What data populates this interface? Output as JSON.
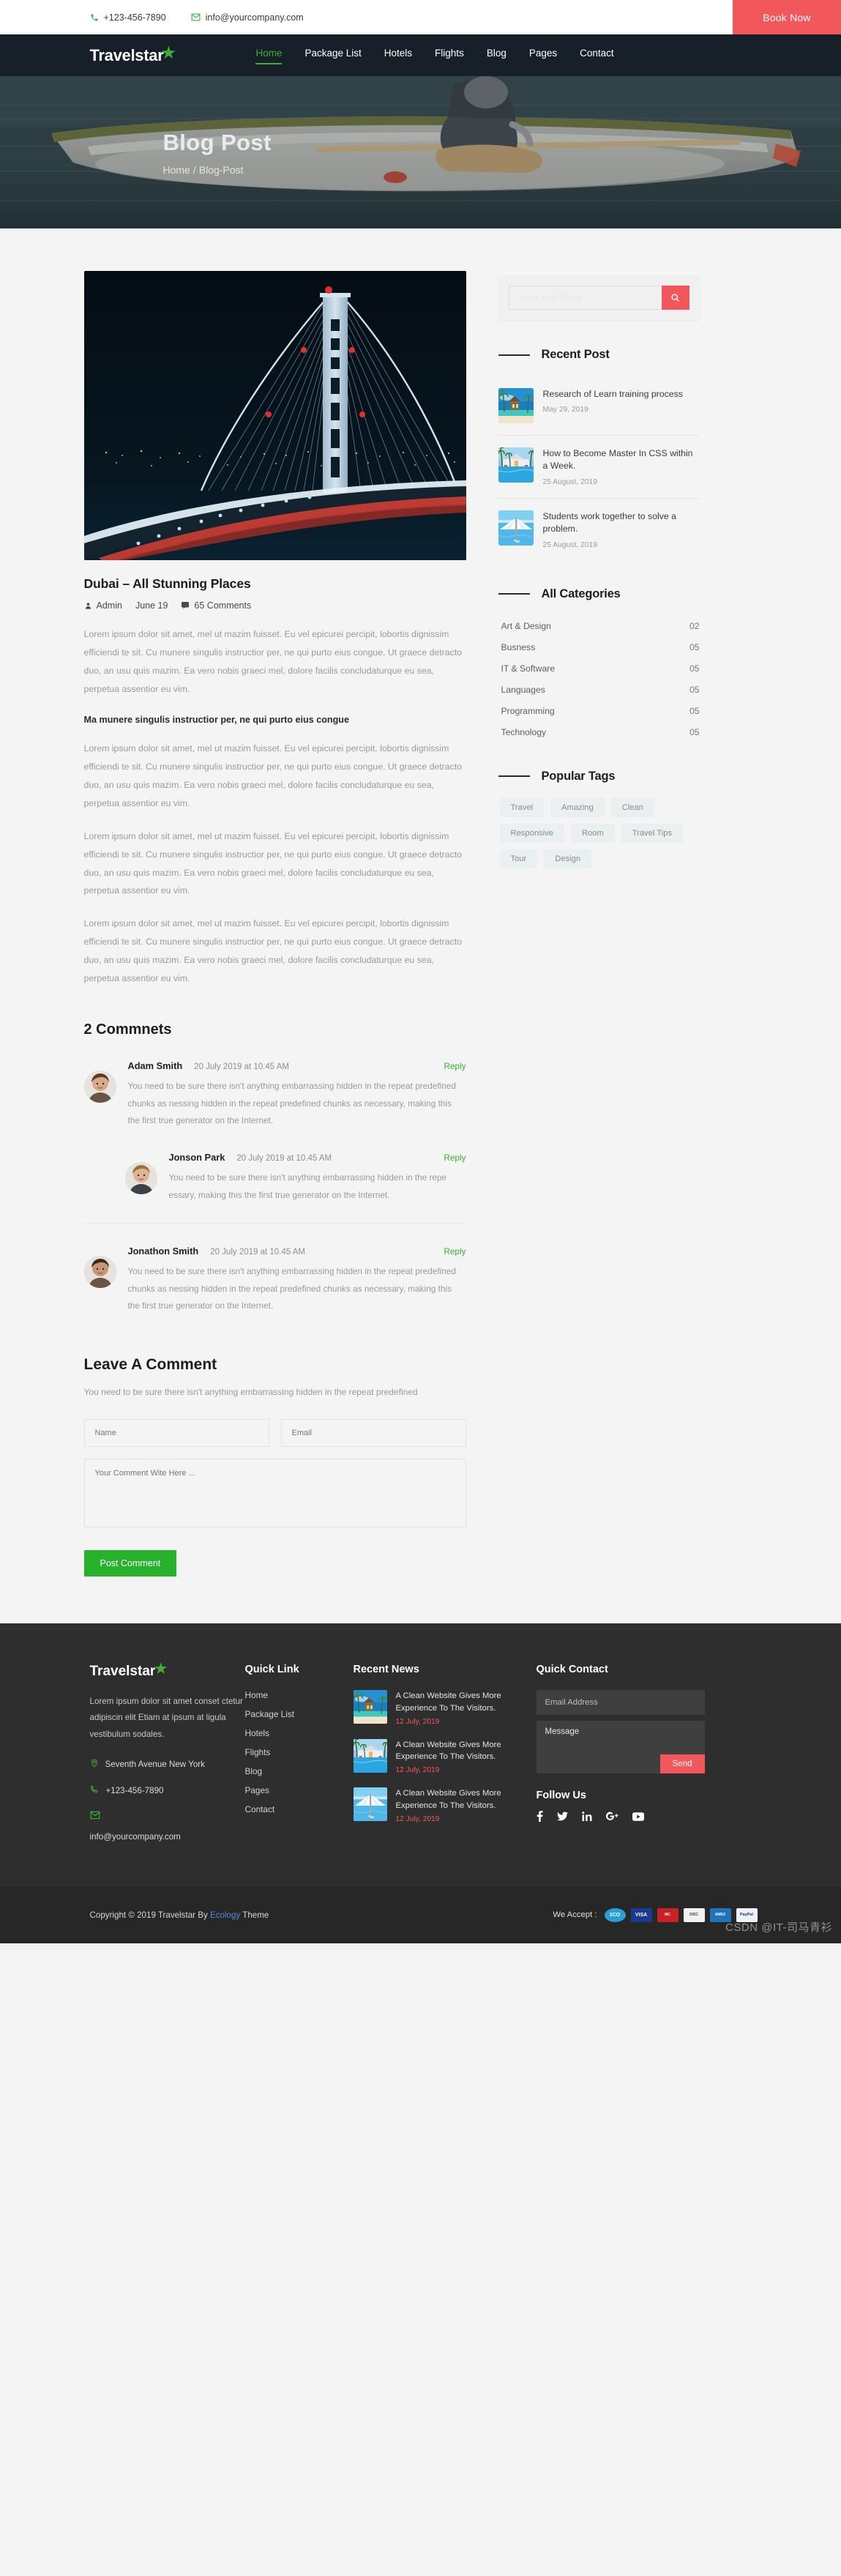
{
  "topbar": {
    "phone": "+123-456-7890",
    "email": "info@yourcompany.com",
    "book_now": "Book Now",
    "phone_icon": "phone-icon",
    "email_icon": "envelope-icon"
  },
  "nav": {
    "logo": "Travelstar",
    "items": [
      {
        "label": "Home",
        "active": true
      },
      {
        "label": "Package List",
        "active": false
      },
      {
        "label": "Hotels",
        "active": false
      },
      {
        "label": "Flights",
        "active": false
      },
      {
        "label": "Blog",
        "active": false
      },
      {
        "label": "Pages",
        "active": false
      },
      {
        "label": "Contact",
        "active": false
      }
    ]
  },
  "hero": {
    "title": "Blog Post",
    "crumb_home": "Home",
    "crumb_sep": "/",
    "crumb_current": "Blog-Post"
  },
  "post": {
    "title": "Dubai – All Stunning Places",
    "author": "Admin",
    "date": "June 19",
    "comments": "65 Comments",
    "author_icon": "user-icon",
    "comment_icon": "comment-icon",
    "paragraphs": [
      "Lorem ipsum dolor sit amet, mel ut mazim fuisset. Eu vel epicurei percipit, lobortis dignissim efficiendi te sit. Cu munere singulis instructior per, ne qui purto eius congue. Ut graece detracto duo, an usu quis mazim. Ea vero nobis graeci mel, dolore facilis concludaturque eu sea, perpetua assentior eu vim."
    ],
    "subheading": "Ma munere singulis instructior per, ne qui purto eius congue",
    "paragraphs_after": [
      "Lorem ipsum dolor sit amet, mel ut mazim fuisset. Eu vel epicurei percipit, lobortis dignissim efficiendi te sit. Cu munere singulis instructior per, ne qui purto eius congue. Ut graece detracto duo, an usu quis mazim. Ea vero nobis graeci mel, dolore facilis concludaturque eu sea, perpetua assentior eu vim.",
      "Lorem ipsum dolor sit amet, mel ut mazim fuisset. Eu vel epicurei percipit, lobortis dignissim efficiendi te sit. Cu munere singulis instructior per, ne qui purto eius congue. Ut graece detracto duo, an usu quis mazim. Ea vero nobis graeci mel, dolore facilis concludaturque eu sea, perpetua assentior eu vim.",
      "Lorem ipsum dolor sit amet, mel ut mazim fuisset. Eu vel epicurei percipit, lobortis dignissim efficiendi te sit. Cu munere singulis instructior per, ne qui purto eius congue. Ut graece detracto duo, an usu quis mazim. Ea vero nobis graeci mel, dolore facilis concludaturque eu sea, perpetua assentior eu vim."
    ]
  },
  "comments": {
    "heading": "2 Commnets",
    "reply_label": "Reply",
    "items": [
      {
        "name": "Adam Smith",
        "date": "20 July 2019 at 10.45 AM",
        "text": "You need to be sure there isn't anything embarrassing hidden in the repeat predefined chunks as nessing hidden in the repeat predefined chunks as necessary, making this the first true generator on the Internet.",
        "is_reply": false
      },
      {
        "name": "Jonson Park",
        "date": "20 July 2019 at 10.45 AM",
        "text": "You need to be sure there isn't anything embarrassing hidden in the repe essary, making this the first true generator on the Internet.",
        "is_reply": true
      },
      {
        "name": "Jonathon Smith",
        "date": "20 July 2019 at 10.45 AM",
        "text": "You need to be sure there isn't anything embarrassing hidden in the repeat predefined chunks as nessing hidden in the repeat predefined chunks as necessary, making this the first true generator on the Internet.",
        "is_reply": false
      }
    ]
  },
  "leave_comment": {
    "heading": "Leave A Comment",
    "subtext": "You need to be sure there isn't anything embarrassing hidden in the repeat predefined",
    "name_placeholder": "Name",
    "email_placeholder": "Email",
    "comment_placeholder": "Your Comment Wite Here ...",
    "submit_label": "Post Comment"
  },
  "sidebar": {
    "search_placeholder": "Write Your Name",
    "search_icon": "search-icon",
    "recent_post": {
      "title": "Recent Post",
      "items": [
        {
          "title": "Research of Learn training process",
          "date": "May 29, 2019",
          "thumb": "beach-bungalow"
        },
        {
          "title": "How to Become Master In CSS within a Week.",
          "date": "25 August, 2019",
          "thumb": "resort-pool"
        },
        {
          "title": "Students work together to solve a problem.",
          "date": "25 August, 2019",
          "thumb": "beach-umbrella"
        }
      ]
    },
    "categories": {
      "title": "All Categories",
      "items": [
        {
          "label": "Art & Design",
          "count": "02"
        },
        {
          "label": "Busness",
          "count": "05"
        },
        {
          "label": "IT & Software",
          "count": "05"
        },
        {
          "label": "Languages",
          "count": "05"
        },
        {
          "label": "Programming",
          "count": "05"
        },
        {
          "label": "Technology",
          "count": "05"
        }
      ]
    },
    "tags": {
      "title": "Popular Tags",
      "items": [
        "Travel",
        "Amazing",
        "Clean",
        "Responsive",
        "Room",
        "Travel Tips",
        "Tour",
        "Design"
      ]
    }
  },
  "footer": {
    "logo": "Travelstar",
    "description": "Lorem ipsum dolor sit amet conset ctetur adipiscin elit Etiam at ipsum at ligula vestibulum sodales.",
    "address": "Seventh Avenue New York",
    "phone": "+123-456-7890",
    "email": "info@yourcompany.com",
    "location_icon": "map-pin-icon",
    "phone_icon": "phone-icon",
    "email_icon": "envelope-icon",
    "quick_link": {
      "title": "Quick Link",
      "items": [
        "Home",
        "Package List",
        "Hotels",
        "Flights",
        "Blog",
        "Pages",
        "Contact"
      ]
    },
    "recent_news": {
      "title": "Recent News",
      "items": [
        {
          "title": "A Clean Website Gives More Experience To The Visitors.",
          "date": "12 July, 2019",
          "thumb": "beach-bungalow"
        },
        {
          "title": "A Clean Website Gives More Experience To The Visitors.",
          "date": "12 July, 2019",
          "thumb": "resort-pool"
        },
        {
          "title": "A Clean Website Gives More Experience To The Visitors.",
          "date": "12 July, 2019",
          "thumb": "beach-umbrella"
        }
      ]
    },
    "quick_contact": {
      "title": "Quick Contact",
      "email_placeholder": "Email Address",
      "message_value": "Message",
      "send_label": "Send"
    },
    "follow_us": {
      "title": "Follow Us",
      "icons": [
        "facebook-icon",
        "twitter-icon",
        "linkedin-icon",
        "google-plus-icon",
        "youtube-icon"
      ]
    }
  },
  "bottom": {
    "copyright_pre": "Copyright © 2019 Travelstar By ",
    "copyright_link": "Ecology",
    "copyright_post": " Theme",
    "accept_label": "We Accept :",
    "cards": [
      "2CO",
      "VISA",
      "MasterCard",
      "DISCOVER",
      "AMERICAN EXPRESS",
      "PayPal"
    ],
    "watermark": "CSDN @IT-司马青衫"
  },
  "colors": {
    "accent_green": "#3fae35",
    "accent_red": "#f2585b",
    "nav_dark": "#172029",
    "footer_dark": "#2e2e2e",
    "post_button_green": "#28b12a"
  }
}
